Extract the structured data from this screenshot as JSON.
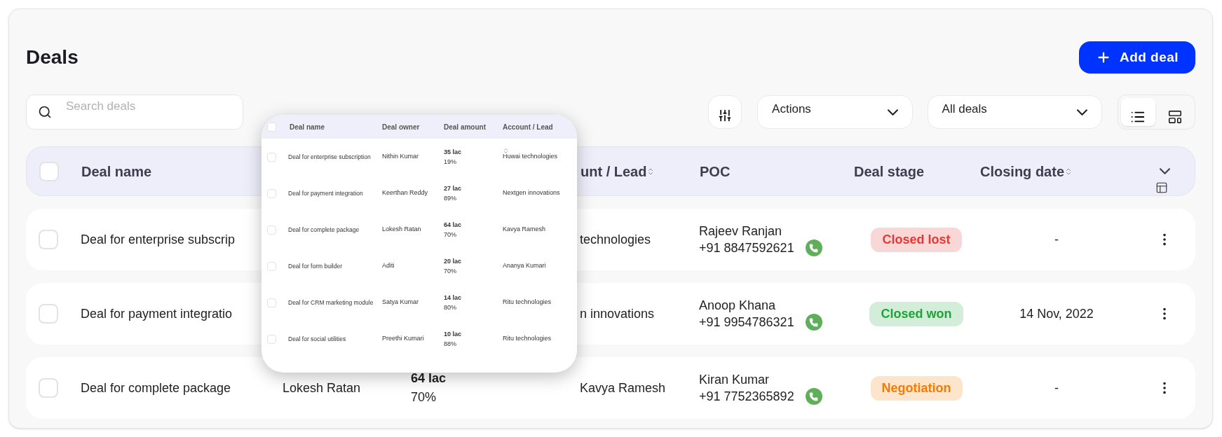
{
  "title": "Deals",
  "add_button": "Add deal",
  "search": {
    "placeholder": "Search deals"
  },
  "dropdowns": [
    {
      "label": "Actions"
    },
    {
      "label": "All deals"
    }
  ],
  "views": [
    {
      "kind": "list",
      "selected": true
    },
    {
      "kind": "board",
      "selected": false
    }
  ],
  "table": {
    "header_checked": false,
    "columns": [
      {
        "label": "Deal name",
        "sortable": false
      },
      {
        "label": "unt / Lead",
        "sortable": true
      },
      {
        "label": "POC",
        "sortable": false
      },
      {
        "label": "Deal stage",
        "sortable": false
      },
      {
        "label": "Closing date",
        "sortable": true
      }
    ],
    "rows": [
      {
        "checked": false,
        "name": "Deal for enterprise subscrip",
        "account": "technologies",
        "poc": "Rajeev Ranjan",
        "phone": "+91 8847592621",
        "stage": "Closed lost",
        "color": "#e53935",
        "closing": "-"
      },
      {
        "checked": false,
        "name": "Deal for payment integratio",
        "account": "n innovations",
        "poc": "Anoop Khana",
        "phone": "+91 9954786321",
        "stage": "Closed won",
        "color": "#1fa33a",
        "closing": "14 Nov, 2022"
      },
      {
        "checked": false,
        "name": "Deal for complete package",
        "owner": "Lokesh Ratan",
        "amount": "64 lac",
        "percent": "70%",
        "account": "Kavya Ramesh",
        "poc": "Kiran Kumar",
        "phone": "+91 7752365892",
        "stage": "Negotiation",
        "color": "#f57c00",
        "closing": "-"
      }
    ]
  },
  "preview": {
    "header_checked": false,
    "columns": [
      "Deal name",
      "Deal owner",
      "Deal amount",
      "Account / Lead"
    ],
    "rows": [
      {
        "checked": false,
        "name": "Deal for enterprise subscription",
        "owner": "Nithin Kumar",
        "amount": "35 lac",
        "percent": "19%",
        "account": "Huwai technologies"
      },
      {
        "checked": false,
        "name": "Deal for payment integration",
        "owner": "Keerthan Reddy",
        "amount": "27 lac",
        "percent": "89%",
        "account": "Nextgen innovations"
      },
      {
        "checked": false,
        "name": "Deal for complete package",
        "owner": "Lokesh Ratan",
        "amount": "64 lac",
        "percent": "70%",
        "account": "Kavya Ramesh"
      },
      {
        "checked": false,
        "name": "Deal for form builder",
        "owner": "Aditi",
        "amount": "20 lac",
        "percent": "70%",
        "account": "Ananya Kumari"
      },
      {
        "checked": false,
        "name": "Deal for CRM marketing module",
        "owner": "Satya Kumar",
        "amount": "14 lac",
        "percent": "80%",
        "account": "Ritu technologies"
      },
      {
        "checked": false,
        "name": "Deal for social utilities",
        "owner": "Preethi Kumari",
        "amount": "10 lac",
        "percent": "88%",
        "account": "Ritu technologies"
      }
    ]
  }
}
